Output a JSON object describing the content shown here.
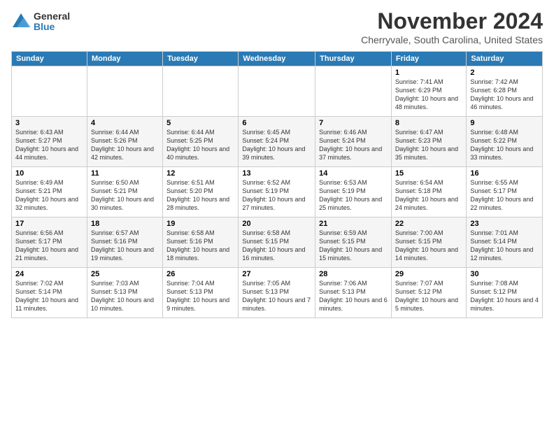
{
  "logo": {
    "general": "General",
    "blue": "Blue"
  },
  "header": {
    "month": "November 2024",
    "location": "Cherryvale, South Carolina, United States"
  },
  "weekdays": [
    "Sunday",
    "Monday",
    "Tuesday",
    "Wednesday",
    "Thursday",
    "Friday",
    "Saturday"
  ],
  "weeks": [
    [
      {
        "day": "",
        "info": ""
      },
      {
        "day": "",
        "info": ""
      },
      {
        "day": "",
        "info": ""
      },
      {
        "day": "",
        "info": ""
      },
      {
        "day": "",
        "info": ""
      },
      {
        "day": "1",
        "info": "Sunrise: 7:41 AM\nSunset: 6:29 PM\nDaylight: 10 hours and 48 minutes."
      },
      {
        "day": "2",
        "info": "Sunrise: 7:42 AM\nSunset: 6:28 PM\nDaylight: 10 hours and 46 minutes."
      }
    ],
    [
      {
        "day": "3",
        "info": "Sunrise: 6:43 AM\nSunset: 5:27 PM\nDaylight: 10 hours and 44 minutes."
      },
      {
        "day": "4",
        "info": "Sunrise: 6:44 AM\nSunset: 5:26 PM\nDaylight: 10 hours and 42 minutes."
      },
      {
        "day": "5",
        "info": "Sunrise: 6:44 AM\nSunset: 5:25 PM\nDaylight: 10 hours and 40 minutes."
      },
      {
        "day": "6",
        "info": "Sunrise: 6:45 AM\nSunset: 5:24 PM\nDaylight: 10 hours and 39 minutes."
      },
      {
        "day": "7",
        "info": "Sunrise: 6:46 AM\nSunset: 5:24 PM\nDaylight: 10 hours and 37 minutes."
      },
      {
        "day": "8",
        "info": "Sunrise: 6:47 AM\nSunset: 5:23 PM\nDaylight: 10 hours and 35 minutes."
      },
      {
        "day": "9",
        "info": "Sunrise: 6:48 AM\nSunset: 5:22 PM\nDaylight: 10 hours and 33 minutes."
      }
    ],
    [
      {
        "day": "10",
        "info": "Sunrise: 6:49 AM\nSunset: 5:21 PM\nDaylight: 10 hours and 32 minutes."
      },
      {
        "day": "11",
        "info": "Sunrise: 6:50 AM\nSunset: 5:21 PM\nDaylight: 10 hours and 30 minutes."
      },
      {
        "day": "12",
        "info": "Sunrise: 6:51 AM\nSunset: 5:20 PM\nDaylight: 10 hours and 28 minutes."
      },
      {
        "day": "13",
        "info": "Sunrise: 6:52 AM\nSunset: 5:19 PM\nDaylight: 10 hours and 27 minutes."
      },
      {
        "day": "14",
        "info": "Sunrise: 6:53 AM\nSunset: 5:19 PM\nDaylight: 10 hours and 25 minutes."
      },
      {
        "day": "15",
        "info": "Sunrise: 6:54 AM\nSunset: 5:18 PM\nDaylight: 10 hours and 24 minutes."
      },
      {
        "day": "16",
        "info": "Sunrise: 6:55 AM\nSunset: 5:17 PM\nDaylight: 10 hours and 22 minutes."
      }
    ],
    [
      {
        "day": "17",
        "info": "Sunrise: 6:56 AM\nSunset: 5:17 PM\nDaylight: 10 hours and 21 minutes."
      },
      {
        "day": "18",
        "info": "Sunrise: 6:57 AM\nSunset: 5:16 PM\nDaylight: 10 hours and 19 minutes."
      },
      {
        "day": "19",
        "info": "Sunrise: 6:58 AM\nSunset: 5:16 PM\nDaylight: 10 hours and 18 minutes."
      },
      {
        "day": "20",
        "info": "Sunrise: 6:58 AM\nSunset: 5:15 PM\nDaylight: 10 hours and 16 minutes."
      },
      {
        "day": "21",
        "info": "Sunrise: 6:59 AM\nSunset: 5:15 PM\nDaylight: 10 hours and 15 minutes."
      },
      {
        "day": "22",
        "info": "Sunrise: 7:00 AM\nSunset: 5:15 PM\nDaylight: 10 hours and 14 minutes."
      },
      {
        "day": "23",
        "info": "Sunrise: 7:01 AM\nSunset: 5:14 PM\nDaylight: 10 hours and 12 minutes."
      }
    ],
    [
      {
        "day": "24",
        "info": "Sunrise: 7:02 AM\nSunset: 5:14 PM\nDaylight: 10 hours and 11 minutes."
      },
      {
        "day": "25",
        "info": "Sunrise: 7:03 AM\nSunset: 5:13 PM\nDaylight: 10 hours and 10 minutes."
      },
      {
        "day": "26",
        "info": "Sunrise: 7:04 AM\nSunset: 5:13 PM\nDaylight: 10 hours and 9 minutes."
      },
      {
        "day": "27",
        "info": "Sunrise: 7:05 AM\nSunset: 5:13 PM\nDaylight: 10 hours and 7 minutes."
      },
      {
        "day": "28",
        "info": "Sunrise: 7:06 AM\nSunset: 5:13 PM\nDaylight: 10 hours and 6 minutes."
      },
      {
        "day": "29",
        "info": "Sunrise: 7:07 AM\nSunset: 5:12 PM\nDaylight: 10 hours and 5 minutes."
      },
      {
        "day": "30",
        "info": "Sunrise: 7:08 AM\nSunset: 5:12 PM\nDaylight: 10 hours and 4 minutes."
      }
    ]
  ]
}
